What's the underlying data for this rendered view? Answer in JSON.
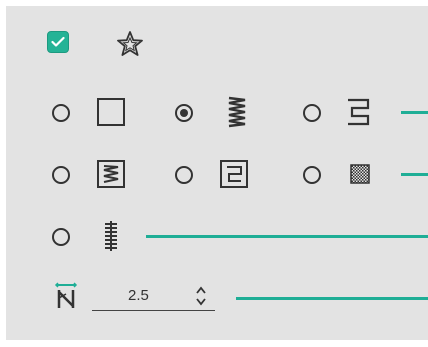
{
  "checkbox": {
    "checked": true
  },
  "stitch_options": [
    {
      "id": "satin-square",
      "selected": false
    },
    {
      "id": "zigzag",
      "selected": true
    },
    {
      "id": "s-curve",
      "selected": false
    },
    {
      "id": "boxed-zigzag",
      "selected": false
    },
    {
      "id": "boxed-s-curve",
      "selected": false
    },
    {
      "id": "crosshatch",
      "selected": false
    },
    {
      "id": "ladder",
      "selected": false
    }
  ],
  "spacing": {
    "value": "2.5"
  },
  "colors": {
    "panel": "#e3e3e3",
    "accent": "#1fae96",
    "checkbox": "#25b396",
    "ink": "#333333"
  }
}
